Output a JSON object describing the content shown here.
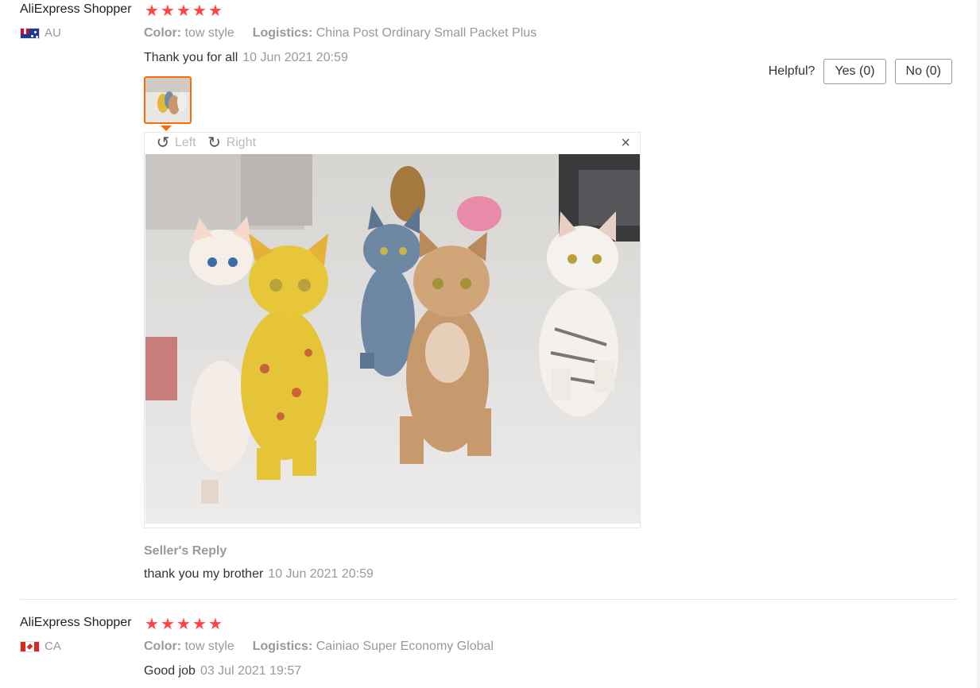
{
  "reviews": [
    {
      "user": "AliExpress Shopper",
      "country": "AU",
      "rating": 5,
      "color_label": "Color:",
      "color_value": "tow style",
      "logistics_label": "Logistics:",
      "logistics_value": "China Post Ordinary Small Packet Plus",
      "text": "Thank you for all",
      "date": "10 Jun 2021 20:59",
      "helpful_label": "Helpful?",
      "yes_label": "Yes (0)",
      "no_label": "No (0)",
      "viewer": {
        "rotate_left": "Left",
        "rotate_right": "Right",
        "photo_alt": "Dancing cat figurines photo"
      },
      "seller_reply_title": "Seller's Reply",
      "seller_reply_text": "thank you my brother",
      "seller_reply_date": "10 Jun 2021 20:59"
    },
    {
      "user": "AliExpress Shopper",
      "country": "CA",
      "rating": 5,
      "color_label": "Color:",
      "color_value": "tow style",
      "logistics_label": "Logistics:",
      "logistics_value": "Cainiao Super Economy Global",
      "text": "Good job",
      "date": "03 Jul 2021 19:57"
    }
  ],
  "icons": {
    "star": "★",
    "rotate_left": "↺",
    "rotate_right": "↻",
    "close": "×"
  },
  "colors": {
    "accent": "#ff6a00",
    "star": "#ff4747",
    "muted_text": "#999999"
  }
}
